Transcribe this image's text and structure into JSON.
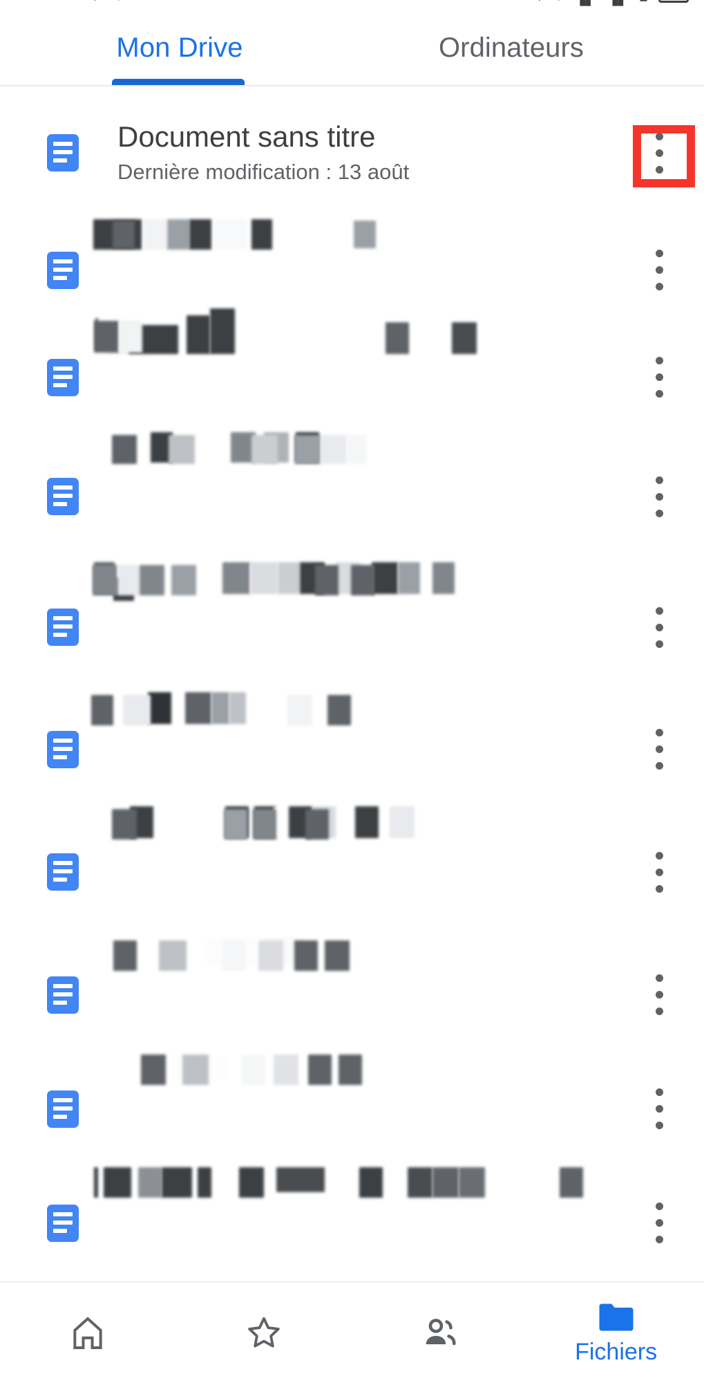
{
  "status_bar": {
    "left_icons": [
      "down-arrow-icon",
      "dot-icon"
    ],
    "right_icons": [
      "down-arrow-icon",
      "circle-icon",
      "signal-icon",
      "signal-icon",
      "wifi-icon",
      "battery-icon"
    ]
  },
  "tabs": [
    {
      "label": "Mon Drive",
      "active": true
    },
    {
      "label": "Ordinateurs",
      "active": false
    }
  ],
  "colors": {
    "accent": "#1a73e8",
    "tab_indicator": "#1967d2",
    "doc_icon": "#4285f4",
    "highlight": "#f5352b",
    "primary_text": "#3c4043",
    "secondary_text": "#5f6368"
  },
  "files": [
    {
      "icon": "google-docs-icon",
      "title": "Document sans titre",
      "subtitle": "Dernière modification : 13 août",
      "redacted": false,
      "highlighted_menu": true
    },
    {
      "icon": "google-docs-icon",
      "title": "",
      "subtitle": "",
      "redacted": true,
      "highlighted_menu": false
    },
    {
      "icon": "google-docs-icon",
      "title": "",
      "subtitle": "",
      "redacted": true,
      "highlighted_menu": false
    },
    {
      "icon": "google-docs-icon",
      "title": "",
      "subtitle": "",
      "redacted": true,
      "highlighted_menu": false
    },
    {
      "icon": "google-docs-icon",
      "title": "",
      "subtitle": "",
      "redacted": true,
      "highlighted_menu": false
    },
    {
      "icon": "google-docs-icon",
      "title": "",
      "subtitle": "",
      "redacted": true,
      "highlighted_menu": false
    },
    {
      "icon": "google-docs-icon",
      "title": "",
      "subtitle": "",
      "redacted": true,
      "highlighted_menu": false
    },
    {
      "icon": "google-docs-icon",
      "title": "",
      "subtitle": "",
      "redacted": true,
      "highlighted_menu": false
    },
    {
      "icon": "google-docs-icon",
      "title": "",
      "subtitle": "",
      "redacted": true,
      "highlighted_menu": false
    },
    {
      "icon": "google-docs-icon",
      "title": "",
      "subtitle": "",
      "redacted": true,
      "highlighted_menu": false
    }
  ],
  "row_menu_icon": "more-vert-icon",
  "bottom_nav": [
    {
      "icon": "home-icon",
      "label": "",
      "active": false
    },
    {
      "icon": "star-icon",
      "label": "",
      "active": false
    },
    {
      "icon": "people-icon",
      "label": "",
      "active": false
    },
    {
      "icon": "folder-icon",
      "label": "Fichiers",
      "active": true
    }
  ]
}
